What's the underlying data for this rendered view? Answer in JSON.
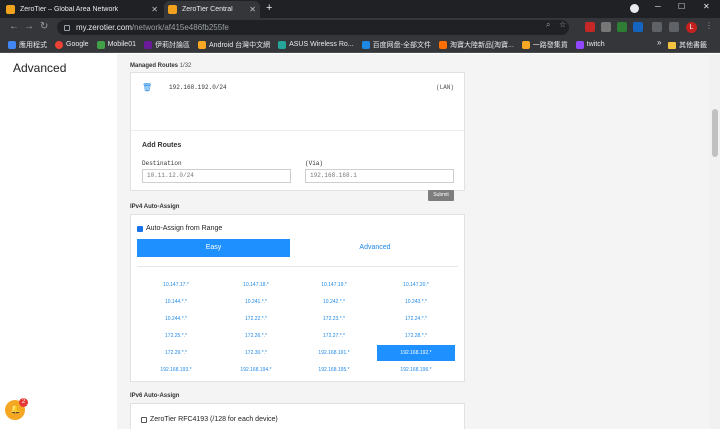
{
  "browser": {
    "tabs": [
      {
        "title": "ZeroTier – Global Area Network",
        "active": false
      },
      {
        "title": "ZeroTier Central",
        "active": true
      }
    ],
    "url_host": "my.zerotier.com",
    "url_path": "/network/af415e486fb255fe",
    "profile_initial": "L",
    "bookmarks": [
      "應用程式",
      "Google",
      "Mobile01",
      "伊莉討論區",
      "Android 台灣中文網",
      "ASUS Wireless Ro...",
      "百度网盘-全部文件",
      "淘寶大陸新品[淘寶...",
      "一路發集貨",
      "twitch"
    ],
    "other_bookmarks": "其他書籤"
  },
  "sidebar": {
    "title": "Advanced"
  },
  "managed_routes": {
    "label": "Managed Routes",
    "count": "1/32",
    "routes": [
      {
        "destination": "192.168.192.0/24",
        "via": "(LAN)"
      }
    ],
    "add_title": "Add Routes",
    "destination_label": "Destination",
    "via_label": "(Via)",
    "destination_placeholder": "10.11.12.0/24",
    "via_placeholder": "192.168.168.1",
    "submit_label": "Submit"
  },
  "ipv4": {
    "label": "IPv4 Auto-Assign",
    "checkbox_label": "Auto-Assign from Range",
    "checked": true,
    "mode_easy": "Easy",
    "mode_advanced": "Advanced",
    "pools": [
      [
        "10.147.17.*",
        "10.147.18.*",
        "10.147.19.*",
        "10.147.20.*"
      ],
      [
        "10.144.*.*",
        "10.241.*.*",
        "10.242.*.*",
        "10.243.*.*"
      ],
      [
        "10.244.*.*",
        "172.22.*.*",
        "172.23.*.*",
        "172.24.*.*"
      ],
      [
        "172.25.*.*",
        "172.26.*.*",
        "172.27.*.*",
        "172.28.*.*"
      ],
      [
        "172.29.*.*",
        "172.30.*.*",
        "192.168.191.*",
        "192.168.192.*"
      ],
      [
        "192.168.193.*",
        "192.168.194.*",
        "192.168.195.*",
        "192.168.196.*"
      ]
    ],
    "selected_pool": "192.168.192.*"
  },
  "ipv6": {
    "label": "IPv6 Auto-Assign",
    "checkbox_label": "ZeroTier RFC4193 (/128 for each device)",
    "checked": false
  },
  "notification": {
    "count": "2"
  },
  "colors": {
    "accent": "#1e90ff",
    "link": "#1e88e5",
    "notification": "#f5a623",
    "badge": "#e53935"
  }
}
